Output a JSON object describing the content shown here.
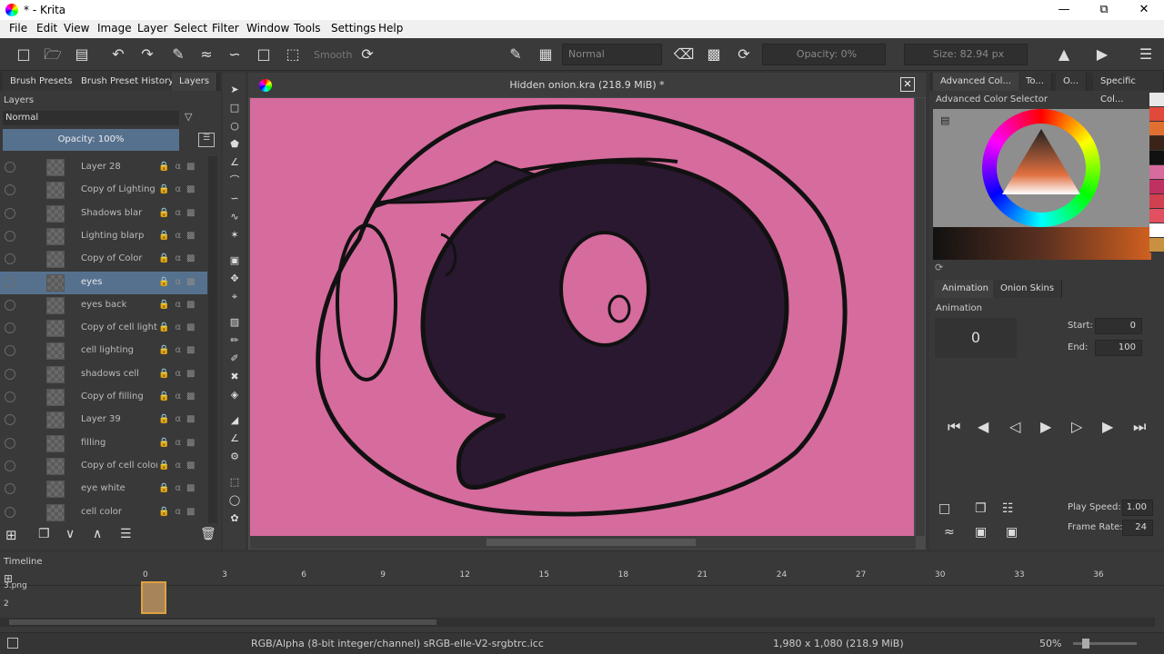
{
  "window": {
    "title": "* - Krita",
    "min": "—",
    "max": "⧉",
    "close": "✕"
  },
  "menu": [
    "File",
    "Edit",
    "View",
    "Image",
    "Layer",
    "Select",
    "Filter",
    "Window",
    "Tools",
    "Settings",
    "Help"
  ],
  "toolbar": {
    "smooth": "Smooth",
    "blend_mode": "Normal",
    "opacity": "Opacity: 0%",
    "size": "Size: 82.94 px"
  },
  "left_tabs": [
    "Brush Presets",
    "Brush Preset History",
    "Layers"
  ],
  "layers_panel": {
    "title": "Layers",
    "blend": "Normal",
    "opacity": "Opacity:  100%",
    "layers": [
      {
        "name": "Layer 28",
        "selected": false
      },
      {
        "name": "Copy of Lighting ...",
        "selected": false
      },
      {
        "name": "Shadows blar",
        "selected": false
      },
      {
        "name": "Lighting blarp",
        "selected": false
      },
      {
        "name": "Copy of Color",
        "selected": false
      },
      {
        "name": "eyes",
        "selected": true
      },
      {
        "name": "eyes back",
        "selected": false
      },
      {
        "name": "Copy of cell lighti...",
        "selected": false
      },
      {
        "name": "cell lighting",
        "selected": false
      },
      {
        "name": "shadows cell",
        "selected": false
      },
      {
        "name": "Copy of filling",
        "selected": false
      },
      {
        "name": "Layer 39",
        "selected": false
      },
      {
        "name": "filling",
        "selected": false
      },
      {
        "name": "Copy of cell color",
        "selected": false
      },
      {
        "name": "eye white",
        "selected": false
      },
      {
        "name": "cell color",
        "selected": false
      }
    ]
  },
  "document": {
    "title": "Hidden onion.kra (218.9 MiB) *",
    "canvas_color": "#d66b9d"
  },
  "right_tabs": [
    "Advanced Col...",
    "To...",
    "O...",
    "Specific Col..."
  ],
  "color_selector": {
    "title": "Advanced Color Selector"
  },
  "animation": {
    "tabs": [
      "Animation",
      "Onion Skins"
    ],
    "title": "Animation",
    "current_frame": "0",
    "start_label": "Start:",
    "start": "0",
    "end_label": "End:",
    "end": "100",
    "play_speed_label": "Play Speed:",
    "play_speed": "1.00",
    "frame_rate_label": "Frame Rate:",
    "frame_rate": "24"
  },
  "timeline": {
    "title": "Timeline",
    "frames": [
      "0",
      "3",
      "6",
      "9",
      "12",
      "15",
      "18",
      "21",
      "24",
      "27",
      "30",
      "33",
      "36"
    ],
    "rows": [
      "3.png",
      "2"
    ]
  },
  "status": {
    "color_space": "RGB/Alpha (8-bit integer/channel)  sRGB-elle-V2-srgbtrc.icc",
    "dimensions": "1,980 x 1,080 (218.9 MiB)",
    "zoom": "50%"
  }
}
